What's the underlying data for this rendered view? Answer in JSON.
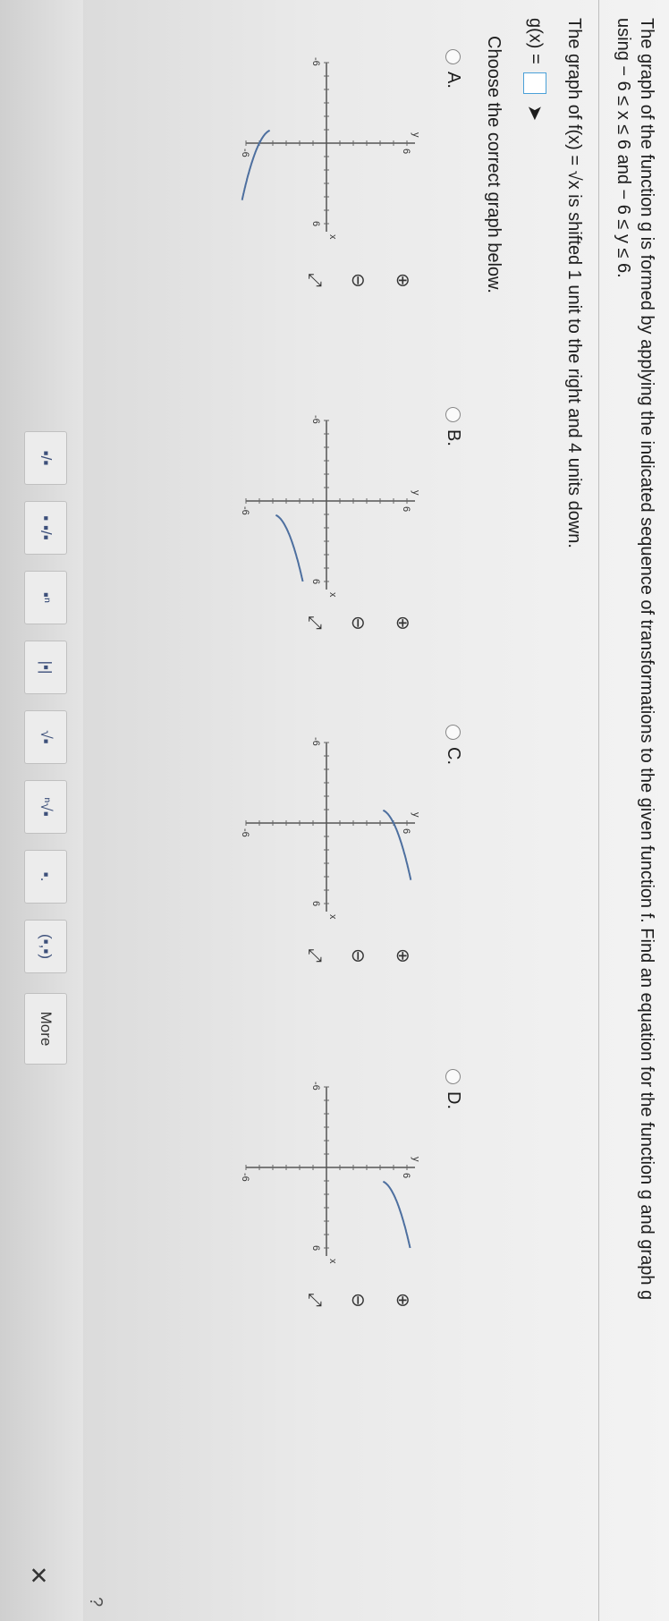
{
  "question": {
    "line1": "The graph of the function g is formed by applying the indicated sequence of transformations to the given function f. Find an equation for the function g and graph g",
    "line2": "using  − 6 ≤ x ≤ 6 and  − 6 ≤ y ≤ 6.",
    "line3_prefix": "The graph of f(x) = ",
    "line3_sqrt": "√x",
    "line3_suffix": " is shifted 1 unit to the right and 4 units down.",
    "answer_prefix": "g(x) =",
    "answer_value": "",
    "prompt": "Choose the correct graph below."
  },
  "options": [
    {
      "label": "A.",
      "selected": false
    },
    {
      "label": "B.",
      "selected": false
    },
    {
      "label": "C.",
      "selected": false
    },
    {
      "label": "D.",
      "selected": false
    }
  ],
  "graph_labels": {
    "tick_neg": "-6",
    "tick_pos": "6",
    "x": "x",
    "y": "y"
  },
  "graph_icons": {
    "zoom_in": "zoom-in-icon",
    "zoom_out": "zoom-out-icon",
    "expand": "expand-icon"
  },
  "toolbar": {
    "items": [
      "▪/▪",
      "▪ ▪/▪",
      "▪ⁿ",
      "|▪|",
      "√▪",
      "ⁿ√▪",
      "▪.",
      "(▪,▪)",
      "More"
    ]
  },
  "colors": {
    "accent": "#4aa0d8",
    "curve": "#4d6f9f",
    "text": "#1d1d1d"
  }
}
